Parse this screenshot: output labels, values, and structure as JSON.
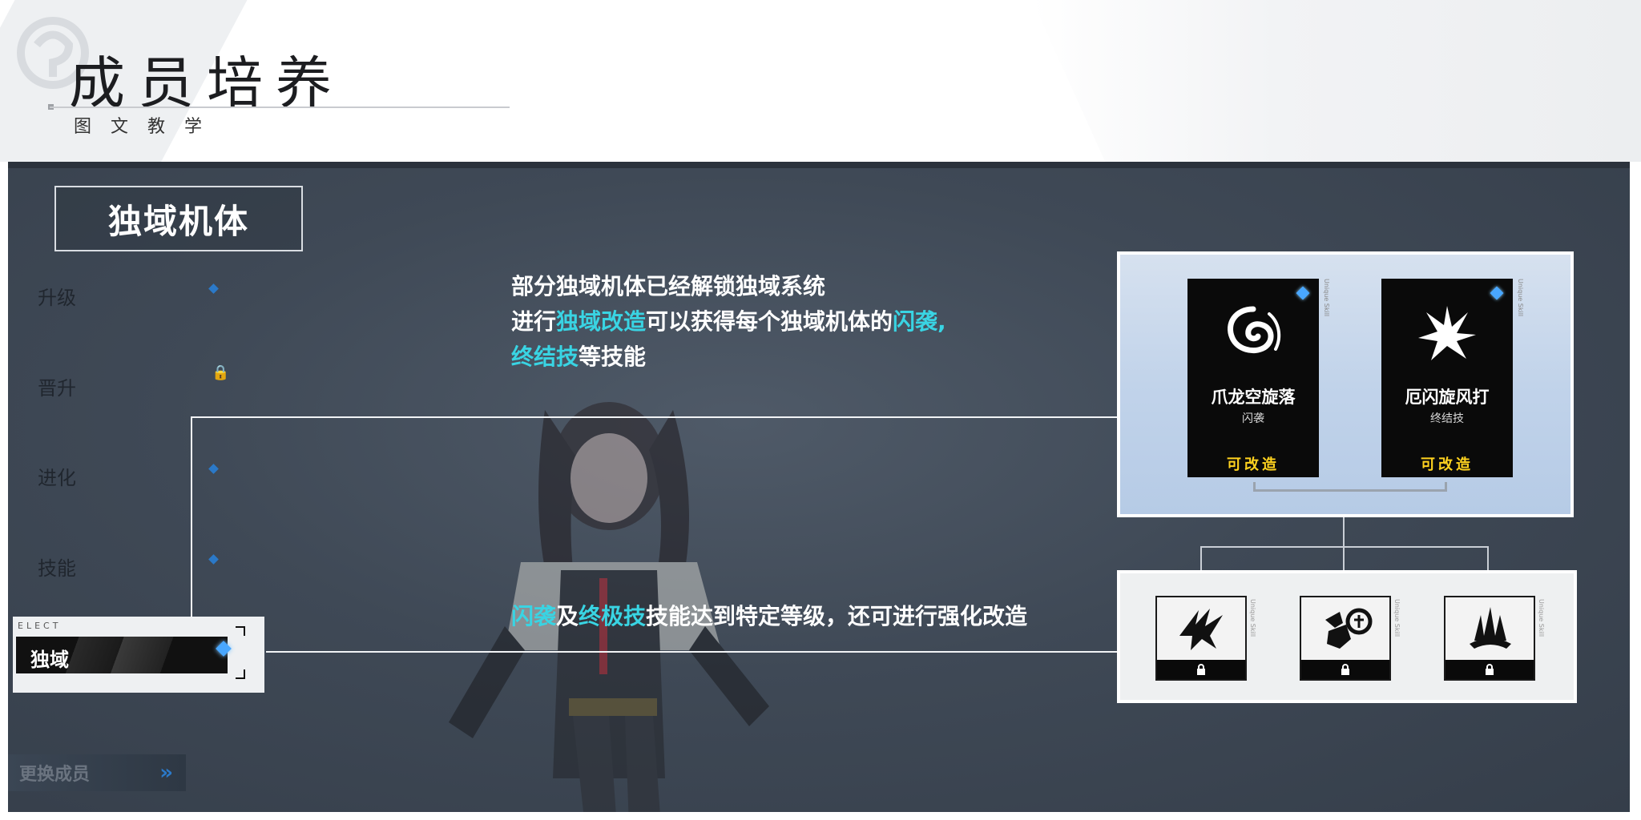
{
  "header": {
    "title": "成员培养",
    "subtitle": "图文教学"
  },
  "screen": {
    "section_tag": "独域机体",
    "sidebar": {
      "items": [
        {
          "label": "升级",
          "state": "dot"
        },
        {
          "label": "晋升",
          "state": "locked"
        },
        {
          "label": "进化",
          "state": "dot"
        },
        {
          "label": "技能",
          "state": "dot"
        }
      ],
      "selected": {
        "caption": "ELECT",
        "label": "独域"
      }
    },
    "swap_button": {
      "label": "更换成员",
      "icon": "double-chevron-right-icon"
    }
  },
  "description_top": {
    "line1": "部分独域机体已经解锁独域系统",
    "line2_pre": "进行",
    "line2_hl1": "独域改造",
    "line2_mid": "可以获得每个独域机体的",
    "line2_hl2": "闪袭,",
    "line3_hl": "终结技",
    "line3_post": "等技能"
  },
  "description_bottom": {
    "hl1": "闪袭",
    "mid1": "及",
    "hl2": "终极技",
    "rest": "技能达到特定等级，还可进行强化改造"
  },
  "skill_cards": [
    {
      "name": "爪龙空旋落",
      "type": "闪袭",
      "status": "可改造",
      "icon": "swirl-icon",
      "side_text": "Unique Skill"
    },
    {
      "name": "厄闪旋风打",
      "type": "终结技",
      "status": "可改造",
      "icon": "burst-icon",
      "side_text": "Unique Skill"
    }
  ],
  "upgrade_cards": [
    {
      "icon": "claw-slash-icon",
      "lock_icon": "lock-icon",
      "side_text": "Unique Skill"
    },
    {
      "icon": "fist-impact-icon",
      "lock_icon": "lock-icon",
      "side_text": "Unique Skill"
    },
    {
      "icon": "spike-crown-icon",
      "lock_icon": "lock-icon",
      "side_text": "Unique Skill"
    }
  ],
  "colors": {
    "highlight": "#39d4e3",
    "status_yellow": "#ffd21f",
    "gem_blue": "#49a7ff",
    "background": "#3f4956"
  }
}
